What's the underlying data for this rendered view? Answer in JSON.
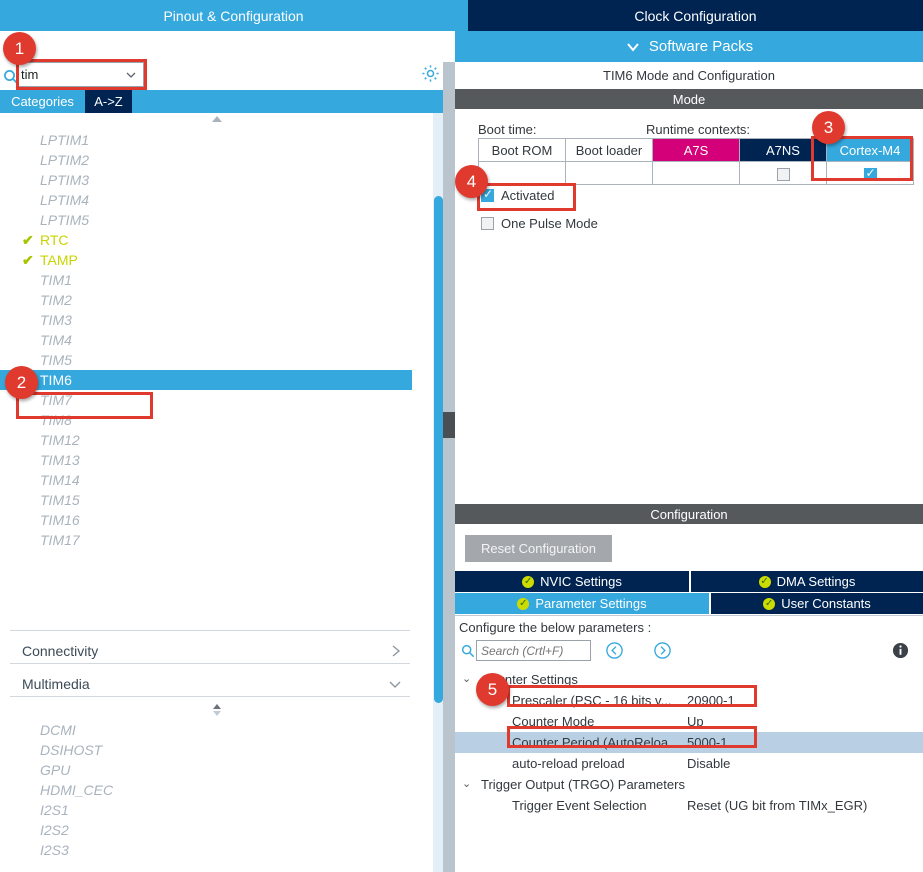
{
  "top_tabs": [
    {
      "label": "Pinout & Configuration",
      "active": true
    },
    {
      "label": "Clock Configuration",
      "active": false
    }
  ],
  "left_panel": {
    "search": {
      "value": "tim",
      "placeholder": ""
    },
    "gear_icon": "gear-icon",
    "sub_tabs": [
      {
        "label": "Categories",
        "active": true
      },
      {
        "label": "A->Z",
        "active": false
      }
    ],
    "peripherals": [
      {
        "label": "LPTIM1",
        "state": "disabled"
      },
      {
        "label": "LPTIM2",
        "state": "disabled"
      },
      {
        "label": "LPTIM3",
        "state": "disabled"
      },
      {
        "label": "LPTIM4",
        "state": "disabled"
      },
      {
        "label": "LPTIM5",
        "state": "disabled"
      },
      {
        "label": "RTC",
        "state": "enabled"
      },
      {
        "label": "TAMP",
        "state": "enabled"
      },
      {
        "label": "TIM1",
        "state": "disabled"
      },
      {
        "label": "TIM2",
        "state": "disabled"
      },
      {
        "label": "TIM3",
        "state": "disabled"
      },
      {
        "label": "TIM4",
        "state": "disabled"
      },
      {
        "label": "TIM5",
        "state": "disabled"
      },
      {
        "label": "TIM6",
        "state": "selected"
      },
      {
        "label": "TIM7",
        "state": "disabled"
      },
      {
        "label": "TIM8",
        "state": "disabled"
      },
      {
        "label": "TIM12",
        "state": "disabled"
      },
      {
        "label": "TIM13",
        "state": "disabled"
      },
      {
        "label": "TIM14",
        "state": "disabled"
      },
      {
        "label": "TIM15",
        "state": "disabled"
      },
      {
        "label": "TIM16",
        "state": "disabled"
      },
      {
        "label": "TIM17",
        "state": "disabled"
      }
    ],
    "categories": [
      {
        "label": "Connectivity",
        "chevron": "chevron-right-icon"
      },
      {
        "label": "Multimedia",
        "chevron": "chevron-down-icon"
      }
    ],
    "multimedia_items": [
      {
        "label": "DCMI"
      },
      {
        "label": "DSIHOST"
      },
      {
        "label": "GPU"
      },
      {
        "label": "HDMI_CEC"
      },
      {
        "label": "I2S1"
      },
      {
        "label": "I2S2"
      },
      {
        "label": "I2S3"
      }
    ]
  },
  "right_panel": {
    "software_packs": "Software Packs",
    "mode_title": "TIM6 Mode and Configuration",
    "mode_section": "Mode",
    "boot_time_label": "Boot time:",
    "runtime_contexts_label": "Runtime contexts:",
    "context_table": {
      "headers": [
        {
          "label": "Boot ROM",
          "style": "plain"
        },
        {
          "label": "Boot loader",
          "style": "plain"
        },
        {
          "label": "A7S",
          "style": "magenta"
        },
        {
          "label": "A7NS",
          "style": "navy"
        },
        {
          "label": "Cortex-M4",
          "style": "cyan"
        }
      ],
      "cells": [
        {
          "checkbox": "none",
          "checked": false
        },
        {
          "checkbox": "none",
          "checked": false
        },
        {
          "checkbox": "none",
          "checked": false
        },
        {
          "checkbox": "unchecked",
          "checked": false
        },
        {
          "checkbox": "checked",
          "checked": true
        }
      ]
    },
    "options": [
      {
        "label": "Activated",
        "checked": true
      },
      {
        "label": "One Pulse Mode",
        "checked": false
      }
    ],
    "configuration_section": "Configuration",
    "reset_button": "Reset Configuration",
    "config_tabs": [
      {
        "label": "NVIC Settings",
        "active": false
      },
      {
        "label": "DMA Settings",
        "active": false
      },
      {
        "label": "Parameter Settings",
        "active": true
      },
      {
        "label": "User Constants",
        "active": false
      }
    ],
    "param_hint": "Configure the below parameters :",
    "param_search": {
      "value": "",
      "placeholder": "Search (Crtl+F)"
    },
    "nav_prev_icon": "arrow-left-circle-icon",
    "nav_next_icon": "arrow-right-circle-icon",
    "info_icon": "info-icon",
    "param_groups": [
      {
        "label": "Counter Settings",
        "rows": [
          {
            "name": "Prescaler (PSC - 16 bits v...",
            "value": "20900-1",
            "highlighted": false
          },
          {
            "name": "Counter Mode",
            "value": "Up",
            "highlighted": false
          },
          {
            "name": "Counter Period (AutoReloa...",
            "value": "5000-1",
            "highlighted": true
          },
          {
            "name": "auto-reload preload",
            "value": "Disable",
            "highlighted": false
          }
        ]
      },
      {
        "label": "Trigger Output (TRGO) Parameters",
        "rows": [
          {
            "name": "Trigger Event Selection",
            "value": "Reset (UG bit from TIMx_EGR)",
            "highlighted": false
          }
        ]
      }
    ]
  },
  "annotations": {
    "accent_color": "#e03a2f",
    "badges": [
      {
        "number": "1",
        "target": "search-input"
      },
      {
        "number": "2",
        "target": "peripheral-tim6"
      },
      {
        "number": "3",
        "target": "cortex-m4-column"
      },
      {
        "number": "4",
        "target": "activated-checkbox"
      },
      {
        "number": "5",
        "target": "prescaler-row"
      }
    ]
  },
  "colors": {
    "brand_blue": "#35a8dd",
    "dark_navy": "#002452",
    "magenta": "#d4007a",
    "section_gray": "#55595c",
    "enabled_green": "#c8d400",
    "annotation_red": "#e03a2f"
  }
}
